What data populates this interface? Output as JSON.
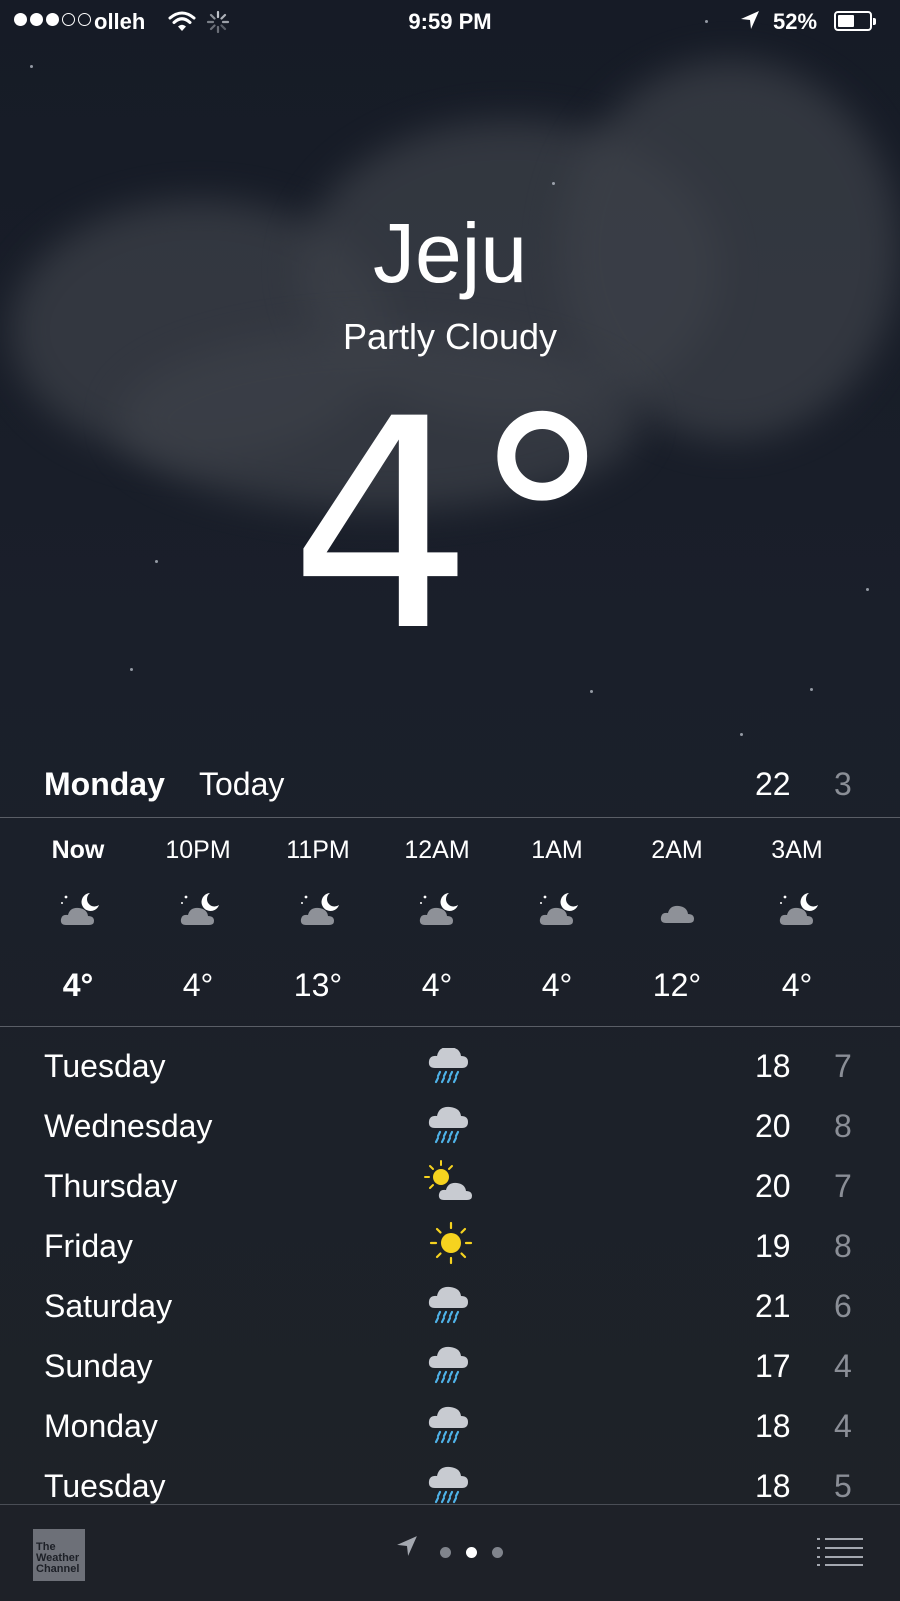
{
  "status_bar": {
    "carrier": "olleh",
    "time": "9:59 PM",
    "battery_percent": "52%",
    "battery_level": 0.52,
    "signal_bars_filled": 3,
    "signal_bars_total": 5,
    "icons": [
      "wifi-icon",
      "activity-spinner-icon",
      "location-arrow-icon",
      "battery-icon"
    ]
  },
  "header": {
    "city": "Jeju",
    "condition": "Partly Cloudy",
    "temperature": "4°"
  },
  "today": {
    "day": "Monday",
    "label": "Today",
    "high": "22",
    "low": "3"
  },
  "hourly": [
    {
      "time": "Now",
      "icon": "partly-cloudy-night-icon",
      "temp": "4°"
    },
    {
      "time": "10PM",
      "icon": "partly-cloudy-night-icon",
      "temp": "4°"
    },
    {
      "time": "11PM",
      "icon": "partly-cloudy-night-icon",
      "temp": "13°"
    },
    {
      "time": "12AM",
      "icon": "partly-cloudy-night-icon",
      "temp": "4°"
    },
    {
      "time": "1AM",
      "icon": "partly-cloudy-night-icon",
      "temp": "4°"
    },
    {
      "time": "2AM",
      "icon": "cloud-icon",
      "temp": "12°"
    },
    {
      "time": "3AM",
      "icon": "partly-cloudy-night-icon",
      "temp": "4°"
    }
  ],
  "daily": [
    {
      "day": "Tuesday",
      "icon": "rain-icon",
      "high": "18",
      "low": "7"
    },
    {
      "day": "Wednesday",
      "icon": "rain-icon",
      "high": "20",
      "low": "8"
    },
    {
      "day": "Thursday",
      "icon": "partly-sunny-icon",
      "high": "20",
      "low": "7"
    },
    {
      "day": "Friday",
      "icon": "sun-icon",
      "high": "19",
      "low": "8"
    },
    {
      "day": "Saturday",
      "icon": "rain-icon",
      "high": "21",
      "low": "6"
    },
    {
      "day": "Sunday",
      "icon": "rain-icon",
      "high": "17",
      "low": "4"
    },
    {
      "day": "Monday",
      "icon": "rain-icon",
      "high": "18",
      "low": "4"
    },
    {
      "day": "Tuesday",
      "icon": "rain-icon",
      "high": "18",
      "low": "5"
    }
  ],
  "bottom_bar": {
    "logo_text": [
      "The",
      "Weather",
      "Channel"
    ],
    "page_count": 3,
    "active_page": 2,
    "icons": [
      "location-arrow-icon",
      "list-icon"
    ]
  },
  "colors": {
    "background": "#1b1f27",
    "text": "#ffffff",
    "secondary_text": "#8a8e96",
    "rain_drops": "#4fb3e8",
    "sun": "#f6d31f",
    "cloud": "#8e9198"
  }
}
